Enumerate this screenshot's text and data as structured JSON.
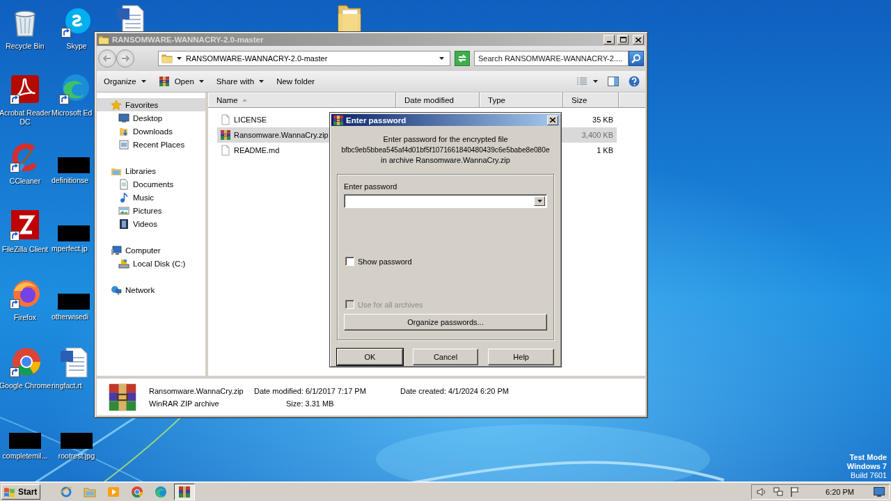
{
  "desktop_icons": [
    {
      "kind": "system",
      "label": "Recycle Bin"
    },
    {
      "kind": "shortcut",
      "label": "Skype"
    },
    {
      "kind": "document"
    },
    {
      "kind": "folder"
    },
    {
      "kind": "shortcut",
      "label": "Acrobat Reader DC"
    },
    {
      "kind": "shortcut",
      "label": "Microsoft Ed"
    },
    {
      "kind": "shortcut",
      "label": "CCleaner"
    },
    {
      "label": "definitionse"
    },
    {
      "kind": "shortcut",
      "label": "FileZilla Client"
    },
    {
      "label": "mperfect.jp"
    },
    {
      "kind": "shortcut",
      "label": "Firefox"
    },
    {
      "label": "otherwisedi"
    },
    {
      "kind": "shortcut",
      "label": "Google Chrome"
    },
    {
      "kind": "document",
      "label": "ringfact.rt"
    },
    {
      "label": "completemil..."
    },
    {
      "label": "rootrest.jpg"
    }
  ],
  "explorer": {
    "title": "RANSOMWARE-WANNACRY-2.0-master",
    "address": "RANSOMWARE-WANNACRY-2.0-master",
    "search": {
      "placeholder": "Search RANSOMWARE-WANNACRY-2...."
    },
    "toolbar": [
      {
        "label": "Organize",
        "menu": true
      },
      {
        "label": "Open",
        "menu": true
      },
      {
        "label": "Share with",
        "menu": true
      },
      {
        "label": "New folder",
        "menu": false
      }
    ],
    "sidebar": [
      {
        "label": "Favorites",
        "selected": true,
        "children": [
          {
            "label": "Desktop",
            "selected": false
          },
          {
            "label": "Downloads",
            "selected": false
          },
          {
            "label": "Recent Places",
            "selected": false
          }
        ]
      },
      {
        "label": "Libraries",
        "selected": false,
        "children": [
          {
            "label": "Documents",
            "selected": false
          },
          {
            "label": "Music",
            "selected": false
          },
          {
            "label": "Pictures",
            "selected": false
          },
          {
            "label": "Videos",
            "selected": false
          }
        ]
      },
      {
        "label": "Computer",
        "selected": false,
        "children": [
          {
            "label": "Local Disk (C:)",
            "selected": false
          }
        ]
      },
      {
        "label": "Network",
        "selected": false
      }
    ],
    "columns": [
      "Name",
      "Date modified",
      "Type",
      "Size"
    ],
    "files": [
      {
        "kind": "file",
        "name": "LICENSE",
        "size": "35 KB",
        "selected": false
      },
      {
        "kind": "archive",
        "name": "Ransomware.WannaCry.zip",
        "size": "3,400 KB",
        "selected": true
      },
      {
        "kind": "file",
        "name": "README.md",
        "size": "1 KB",
        "selected": false
      }
    ],
    "details": {
      "name": "Ransomware.WannaCry.zip",
      "type": "WinRAR ZIP archive",
      "modified": "Date modified: 6/1/2017 7:17 PM",
      "size": "Size: 3.31 MB",
      "created": "Date created: 4/1/2024 6:20 PM"
    }
  },
  "dialog": {
    "title": "Enter password",
    "message": [
      "Enter password for the encrypted file",
      "bfbc9eb5bbea545af4d01bf5f1071661840480439c6e5babe8e080e",
      "in archive Ransomware.WannaCry.zip"
    ],
    "field_label": "Enter password",
    "options": [
      {
        "label": "Show password",
        "checked": false,
        "disabled": false
      },
      {
        "label": "Use for all archives",
        "checked": false,
        "disabled": true
      }
    ],
    "organize_button": "Organize passwords...",
    "buttons": [
      "OK",
      "Cancel",
      "Help"
    ]
  },
  "taskbar": {
    "start": "Start",
    "apps": [
      {
        "selected": false
      },
      {
        "selected": false
      },
      {
        "selected": false
      },
      {
        "selected": false
      },
      {
        "selected": false
      },
      {
        "selected": true
      }
    ],
    "clock": "6:20 PM"
  },
  "system_notice": [
    "Test Mode",
    "Windows 7",
    "Build 7601"
  ]
}
